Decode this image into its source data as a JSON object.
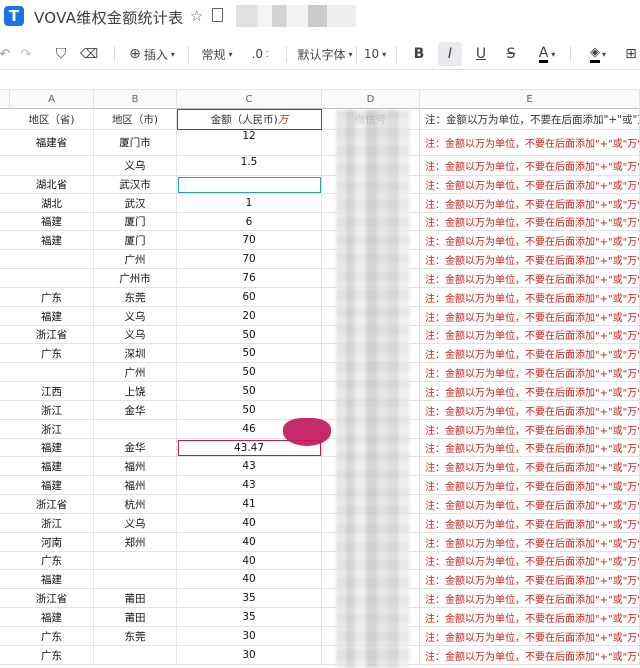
{
  "app": {
    "title": "VOVA维权金额统计表"
  },
  "toolbar": {
    "insert_label": "插入",
    "format_label": "常规",
    "decimal_label": ".0",
    "font_label": "默认字体",
    "size_label": "10",
    "bold": "B",
    "italic": "I",
    "underline": "U",
    "strike": "S",
    "textcolor": "A"
  },
  "columns": [
    "A",
    "B",
    "C",
    "D",
    "E"
  ],
  "headers": {
    "a": "地区（省)",
    "b": "地区（市)",
    "c": "金额（人民币)",
    "c_suffix": "万",
    "d": "微信号"
  },
  "note": "注：金额以万为单位，不要在后面添加\"+\"或\"万\"",
  "rows": [
    {
      "a": "福建省",
      "b": "厦门市",
      "c": "12"
    },
    {
      "a": "",
      "b": "义乌",
      "c": "1.5"
    },
    {
      "a": "湖北省",
      "b": "武汉市",
      "c": ""
    },
    {
      "a": "湖北",
      "b": "武汉",
      "c": "1"
    },
    {
      "a": "福建",
      "b": "厦门",
      "c": "6"
    },
    {
      "a": "福建",
      "b": "厦门",
      "c": "70"
    },
    {
      "a": "",
      "b": "广州",
      "c": "70"
    },
    {
      "a": "",
      "b": "广州市",
      "c": "76"
    },
    {
      "a": "广东",
      "b": "东莞",
      "c": "60"
    },
    {
      "a": "福建",
      "b": "义乌",
      "c": "20"
    },
    {
      "a": "浙江省",
      "b": "义乌",
      "c": "50"
    },
    {
      "a": "广东",
      "b": "深圳",
      "c": "50"
    },
    {
      "a": "",
      "b": "广州",
      "c": "50"
    },
    {
      "a": "江西",
      "b": "上饶",
      "c": "50"
    },
    {
      "a": "浙江",
      "b": "金华",
      "c": "50"
    },
    {
      "a": "浙江",
      "b": "",
      "c": "46"
    },
    {
      "a": "福建",
      "b": "金华",
      "c": "43.47"
    },
    {
      "a": "福建",
      "b": "福州",
      "c": "43"
    },
    {
      "a": "福建",
      "b": "福州",
      "c": "43"
    },
    {
      "a": "浙江省",
      "b": "杭州",
      "c": "41"
    },
    {
      "a": "浙江",
      "b": "义乌",
      "c": "40"
    },
    {
      "a": "河南",
      "b": "郑州",
      "c": "40"
    },
    {
      "a": "广东",
      "b": "",
      "c": "40"
    },
    {
      "a": "福建",
      "b": "",
      "c": "40"
    },
    {
      "a": "浙江省",
      "b": "莆田",
      "c": "35"
    },
    {
      "a": "福建",
      "b": "莆田",
      "c": "35"
    },
    {
      "a": "广东",
      "b": "东莞",
      "c": "30"
    },
    {
      "a": "广东",
      "b": "",
      "c": "30"
    }
  ]
}
